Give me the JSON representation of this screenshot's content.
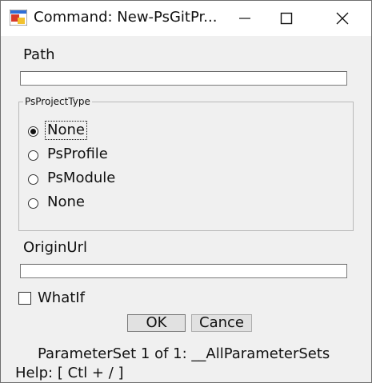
{
  "window": {
    "title": "Command: New-PsGitPr...",
    "controls": [
      "minimize-icon",
      "maximize-icon",
      "close-icon"
    ]
  },
  "form": {
    "path_label": "Path",
    "path_value": "",
    "group_label": "PsProjectType",
    "radio_options": [
      "None",
      "PsProfile",
      "PsModule",
      "None"
    ],
    "selected_option": "None",
    "origin_label": "OriginUrl",
    "origin_value": "",
    "whatif_label": "WhatIf",
    "whatif_checked": false
  },
  "buttons": {
    "ok": "OK",
    "cancel": "Cance"
  },
  "status": {
    "parameter_set": "ParameterSet 1 of 1: __AllParameterSets",
    "help": "Help: [ Ctl + / ]"
  }
}
